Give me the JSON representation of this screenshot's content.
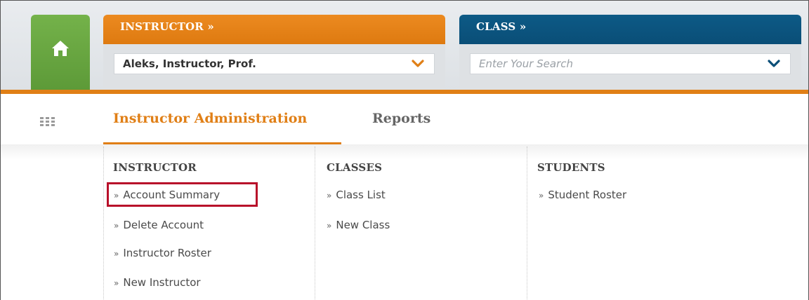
{
  "header": {
    "instructor_tab": {
      "label": "INSTRUCTOR »",
      "selected_value": "Aleks, Instructor, Prof."
    },
    "class_tab": {
      "label": "CLASS »",
      "search_placeholder": "Enter Your Search"
    }
  },
  "nav": {
    "items": [
      {
        "label": "Instructor Administration",
        "active": true
      },
      {
        "label": "Reports",
        "active": false
      }
    ]
  },
  "menu": {
    "columns": [
      {
        "heading": "INSTRUCTOR",
        "links": [
          "Account Summary",
          "Delete Account",
          "Instructor Roster",
          "New Instructor"
        ]
      },
      {
        "heading": "CLASSES",
        "links": [
          "Class List",
          "New Class"
        ]
      },
      {
        "heading": "STUDENTS",
        "links": [
          "Student Roster"
        ]
      }
    ],
    "link_prefix": "»"
  },
  "colors": {
    "orange_accent": "#e07f16",
    "home_green": "#68a843",
    "class_blue": "#0a4e77",
    "highlight_red": "#b8102a"
  },
  "icons": {
    "home": "home-icon",
    "grid": "grid-icon",
    "chevron": "chevron-down-icon"
  }
}
